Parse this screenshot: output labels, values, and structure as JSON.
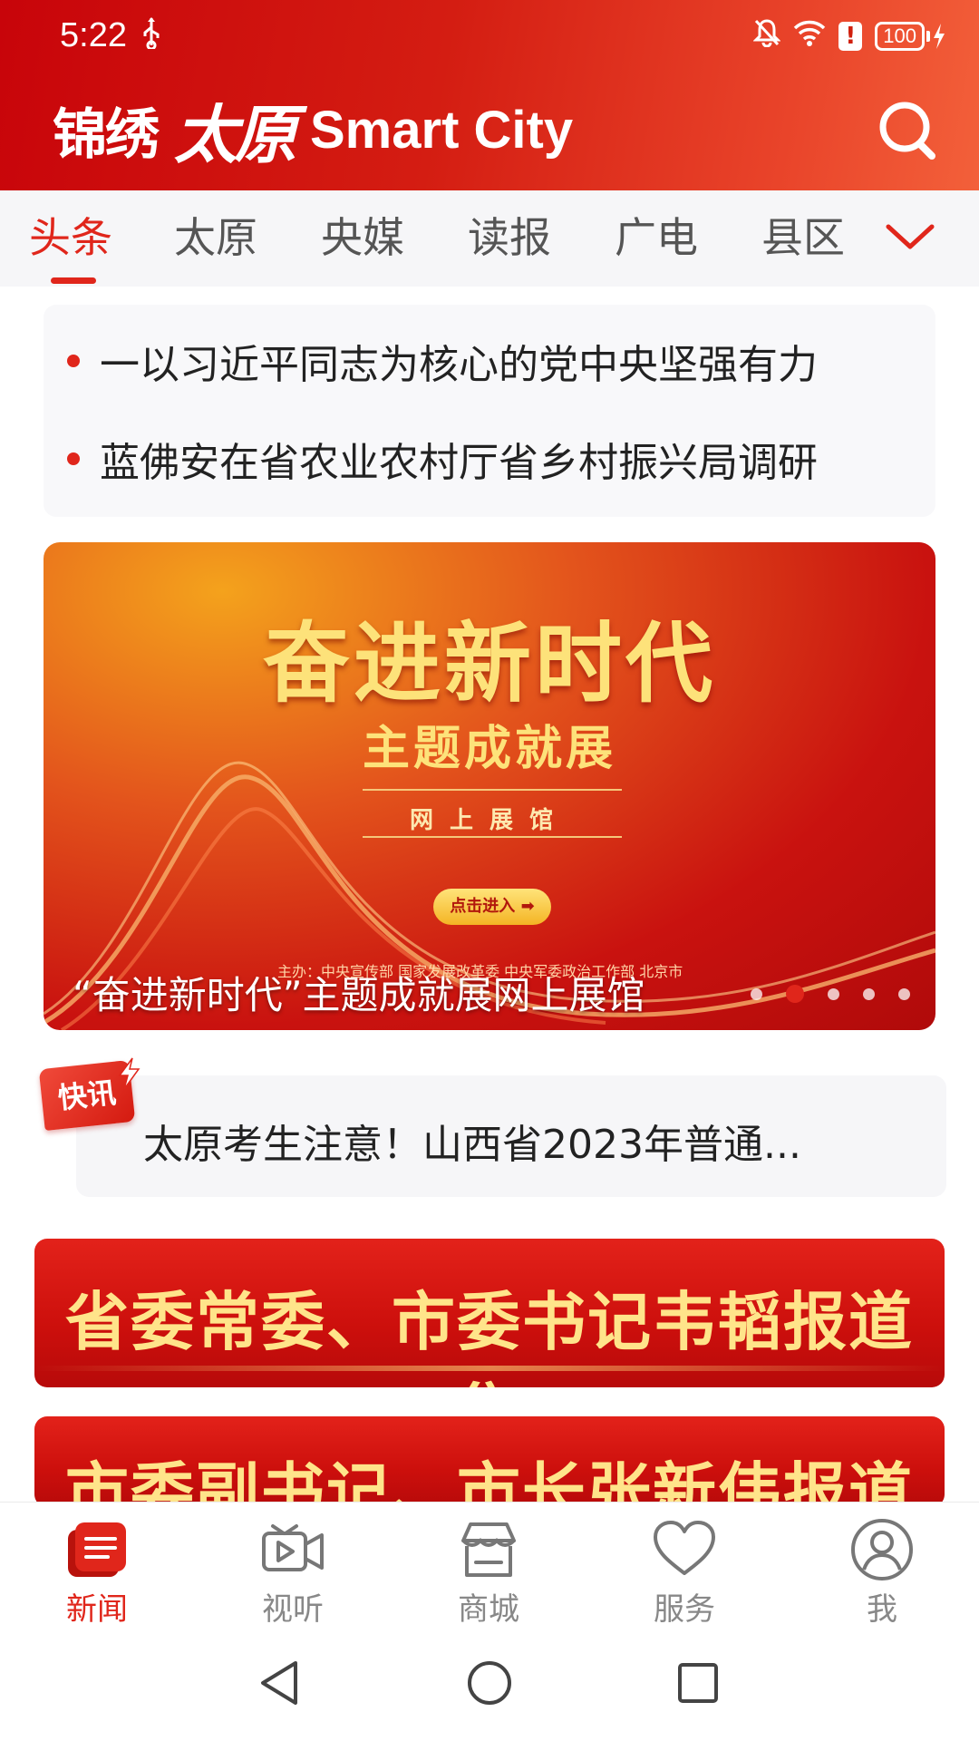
{
  "status_bar": {
    "time": "5:22",
    "usb_icon": "usb-icon",
    "battery": "100"
  },
  "header": {
    "brand_cn": "锦绣",
    "brand_script": "太原",
    "brand_en": "Smart City",
    "search_icon": "search-icon"
  },
  "tabs": [
    {
      "label": "头条",
      "active": true
    },
    {
      "label": "太原",
      "active": false
    },
    {
      "label": "央媒",
      "active": false
    },
    {
      "label": "读报",
      "active": false
    },
    {
      "label": "广电",
      "active": false
    },
    {
      "label": "县区",
      "active": false
    }
  ],
  "headlines": [
    "一以习近平同志为核心的党中央坚强有力",
    "蓝佛安在省农业农村厅省乡村振兴局调研"
  ],
  "banner": {
    "title": "奋进新时代",
    "subtitle": "主题成就展",
    "hall": "网上展馆",
    "button": "点击进入",
    "organizers": "主办：中央宣传部 国家发展改革委 中央军委政治工作部 北京市",
    "caption": "“奋进新时代”主题成就展网上展馆",
    "slide_count": 5,
    "active_slide": 1
  },
  "flash": {
    "badge": "快讯",
    "text": "太原考生注意！山西省2023年普通..."
  },
  "promos": [
    "省委常委、市委书记韦韬报道集",
    "市委副书记、市长张新伟报道集"
  ],
  "bottom_nav": [
    {
      "label": "新闻",
      "icon": "news-icon",
      "active": true
    },
    {
      "label": "视听",
      "icon": "video-icon",
      "active": false
    },
    {
      "label": "商城",
      "icon": "store-icon",
      "active": false
    },
    {
      "label": "服务",
      "icon": "heart-icon",
      "active": false
    },
    {
      "label": "我",
      "icon": "user-icon",
      "active": false
    }
  ],
  "colors": {
    "accent": "#e0261b",
    "header_start": "#c8040a",
    "header_end": "#f3603a"
  }
}
